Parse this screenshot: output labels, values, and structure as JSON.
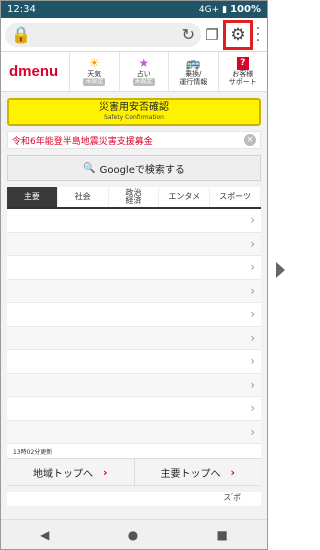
{
  "status": {
    "time": "12:34",
    "signal": "4G+",
    "battery": "100%"
  },
  "browser": {
    "url": "",
    "tab_icon": "tabs-icon",
    "settings_icon": "gear-icon"
  },
  "header": {
    "logo": "dmenu",
    "nav": [
      {
        "icon": "☀",
        "label": "天気",
        "badge": "未設定"
      },
      {
        "icon": "★",
        "label": "占い",
        "badge": "未設定"
      },
      {
        "icon": "🚌",
        "label": "乗換/\n運行情報",
        "badge": ""
      },
      {
        "icon": "?",
        "label": "お客様\nサポート",
        "badge": ""
      }
    ]
  },
  "emergency": {
    "title_ja": "災害用安否確認",
    "title_en": "Safety Confirmation"
  },
  "notice": {
    "text": "令和6年能登半島地震災害支援募金",
    "close": "×"
  },
  "search": {
    "label": "Googleで検索する"
  },
  "tabs": [
    {
      "label": "主要"
    },
    {
      "label": "社会"
    },
    {
      "label": "政治\n経済"
    },
    {
      "label": "エンタメ"
    },
    {
      "label": "スポーツ"
    }
  ],
  "news": [
    {
      "text": ""
    },
    {
      "text": ""
    },
    {
      "text": ""
    },
    {
      "text": ""
    },
    {
      "text": ""
    },
    {
      "text": ""
    },
    {
      "text": ""
    },
    {
      "text": ""
    },
    {
      "text": ""
    },
    {
      "text": ""
    }
  ],
  "updated": "13時02分更新",
  "bottom_links": [
    {
      "label": "地域トップへ"
    },
    {
      "label": "主要トップへ"
    }
  ],
  "peek_label": "ス ゙ポ"
}
